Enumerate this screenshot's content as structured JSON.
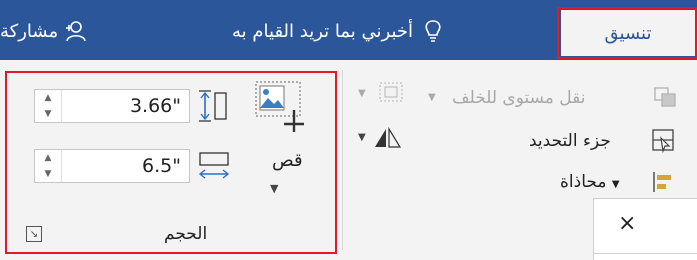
{
  "tabs": {
    "format": "تنسيق"
  },
  "tell_me": {
    "text": "أخبرني بما تريد القيام به",
    "icon": "lightbulb-icon"
  },
  "share": {
    "text": "مشاركة",
    "icon": "person-add-icon"
  },
  "arrange": {
    "send_backward": "نقل مستوى للخلف",
    "selection_pane": "جزء التحديد",
    "align": "محاذاة"
  },
  "size": {
    "height_value": "3.66\"",
    "width_value": "6.5\"",
    "crop_label": "قص",
    "group_label": "الحجم"
  },
  "popup": {
    "close_glyph": "×"
  },
  "colors": {
    "accent": "#2b579a",
    "highlight": "#e3192b"
  }
}
